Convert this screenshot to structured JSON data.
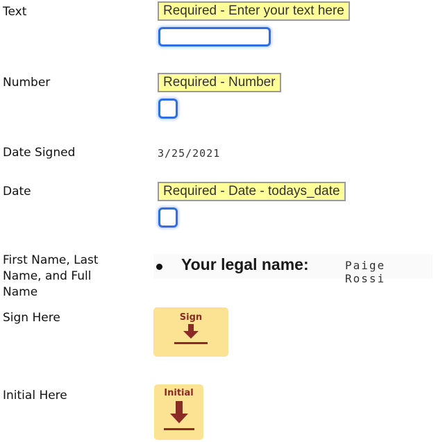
{
  "fields": {
    "text": {
      "label": "Text",
      "tooltip": "Required - Enter your text here",
      "value": ""
    },
    "number": {
      "label": "Number",
      "tooltip": "Required - Number",
      "value": ""
    },
    "date_signed": {
      "label": "Date Signed",
      "value": "3/25/2021"
    },
    "date": {
      "label": "Date",
      "tooltip": "Required - Date - todays_date",
      "value": ""
    },
    "name": {
      "label": "First Name, Last Name, and Full Name",
      "label_lines": [
        "First Name, Last",
        "Name, and Full",
        "Name"
      ],
      "doc_label": "Your legal name:",
      "value": "Paige Rossi"
    },
    "sign": {
      "label": "Sign Here",
      "tag_label": "Sign",
      "icon": "download-arrow-icon"
    },
    "initial": {
      "label": "Initial Here",
      "tag_label": "Initial",
      "icon": "download-arrow-icon"
    }
  },
  "colors": {
    "tooltip_bg": "#ffff99",
    "field_border": "#2f6fde",
    "tag_bg": "#fce293",
    "tag_fg": "#8a2b26"
  }
}
